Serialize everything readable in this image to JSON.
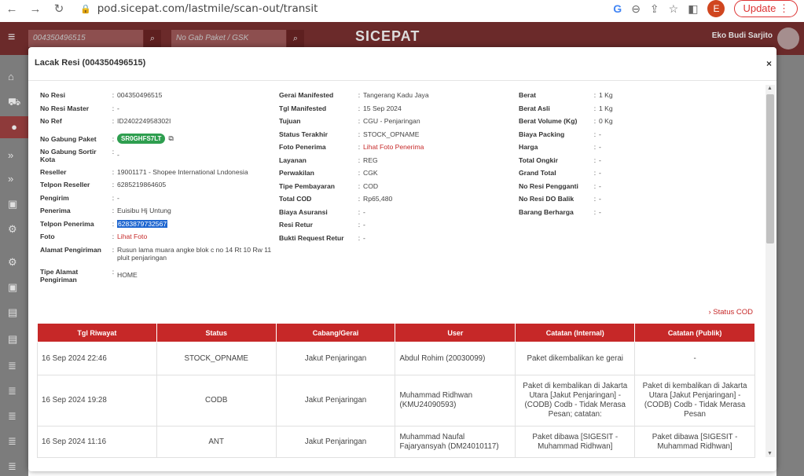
{
  "browser": {
    "url": "pod.sicepat.com/lastmile/scan-out/transit",
    "avatar_letter": "E",
    "update_label": "Update"
  },
  "app": {
    "search1_placeholder": "004350496515",
    "search2_placeholder": "No Gab Paket / GSK",
    "logo": "SICEPAT",
    "user_name": "Eko Budi Sarjito"
  },
  "modal": {
    "title": "Lacak Resi (004350496515)",
    "close": "×",
    "col1": [
      {
        "k": "No Resi",
        "v": "004350496515"
      },
      {
        "k": "No Resi Master",
        "v": "-"
      },
      {
        "k": "No Ref",
        "v": "ID240224958302I"
      },
      {
        "k": "No Gabung Paket",
        "v": "SR0GHFS7LT"
      },
      {
        "k": "No Gabung Sortir Kota",
        "v": "-"
      },
      {
        "k": "Reseller",
        "v": "19001171 - Shopee International Lndonesia"
      },
      {
        "k": "Telpon Reseller",
        "v": "6285219864605"
      },
      {
        "k": "Pengirim",
        "v": "-"
      },
      {
        "k": "Penerima",
        "v": "Euisibu Hj Untung"
      },
      {
        "k": "Telpon Penerima",
        "v": "6283879732567"
      },
      {
        "k": "Foto",
        "v": "Lihat Foto"
      },
      {
        "k": "Alamat Pengiriman",
        "v": "Rusun lama muara angke blok c no 14 Rt 10 Rw 11 pluit penjaringan"
      },
      {
        "k": "Tipe Alamat Pengiriman",
        "v": "HOME"
      }
    ],
    "col2": [
      {
        "k": "Gerai Manifested",
        "v": "Tangerang Kadu Jaya"
      },
      {
        "k": "Tgl Manifested",
        "v": "15 Sep 2024"
      },
      {
        "k": "Tujuan",
        "v": "CGU - Penjaringan"
      },
      {
        "k": "Status Terakhir",
        "v": "STOCK_OPNAME"
      },
      {
        "k": "Foto Penerima",
        "v": "Lihat Foto Penerima"
      },
      {
        "k": "Layanan",
        "v": "REG"
      },
      {
        "k": "Perwakilan",
        "v": "CGK"
      },
      {
        "k": "Tipe Pembayaran",
        "v": "COD"
      },
      {
        "k": "Total COD",
        "v": "Rp65,480"
      },
      {
        "k": "Biaya Asuransi",
        "v": "-"
      },
      {
        "k": "Resi Retur",
        "v": "-"
      },
      {
        "k": "Bukti Request Retur",
        "v": "-"
      }
    ],
    "col3": [
      {
        "k": "Berat",
        "v": "1 Kg"
      },
      {
        "k": "Berat Asli",
        "v": "1 Kg"
      },
      {
        "k": "Berat Volume (Kg)",
        "v": "0 Kg"
      },
      {
        "k": "Biaya Packing",
        "v": "-"
      },
      {
        "k": "Harga",
        "v": "-"
      },
      {
        "k": "Total Ongkir",
        "v": "-"
      },
      {
        "k": "Grand Total",
        "v": "-"
      },
      {
        "k": "No Resi Pengganti",
        "v": "-"
      },
      {
        "k": "No Resi DO Balik",
        "v": "-"
      },
      {
        "k": "Barang Berharga",
        "v": "-"
      }
    ],
    "status_cod_link": "› Status COD",
    "history": {
      "headers": [
        "Tgl Riwayat",
        "Status",
        "Cabang/Gerai",
        "User",
        "Catatan (Internal)",
        "Catatan (Publik)"
      ],
      "rows": [
        [
          "16 Sep 2024 22:46",
          "STOCK_OPNAME",
          "Jakut Penjaringan",
          "Abdul Rohim (20030099)",
          "Paket dikembalikan ke gerai",
          "-"
        ],
        [
          "16 Sep 2024 19:28",
          "CODB",
          "Jakut Penjaringan",
          "Muhammad Ridhwan (KMU24090593)",
          "Paket di kembalikan di Jakarta Utara [Jakut Penjaringan] - (CODB) Codb - Tidak Merasa Pesan; catatan:",
          "Paket di kembalikan di Jakarta Utara [Jakut Penjaringan] - (CODB) Codb - Tidak Merasa Pesan"
        ],
        [
          "16 Sep 2024 11:16",
          "ANT",
          "Jakut Penjaringan",
          "Muhammad Naufal Fajaryansyah (DM24010117)",
          "Paket dibawa [SIGESIT - Muhammad Ridhwan]",
          "Paket dibawa [SIGESIT - Muhammad Ridhwan]"
        ]
      ]
    }
  }
}
